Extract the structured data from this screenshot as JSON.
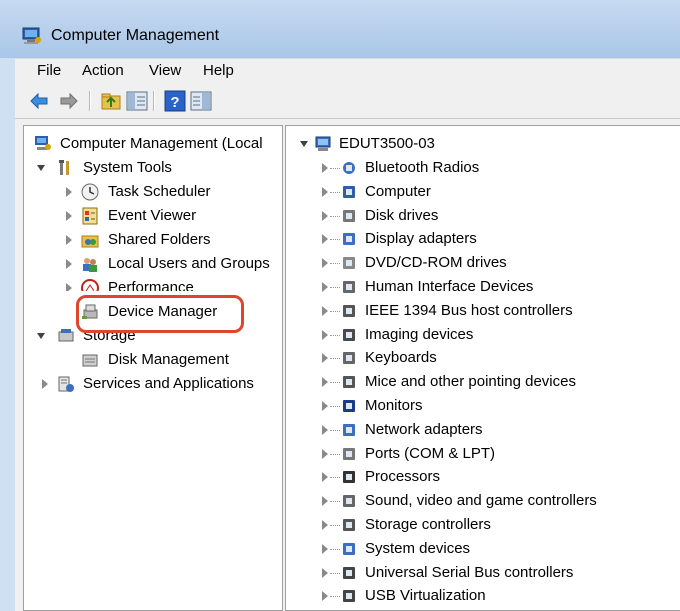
{
  "window": {
    "title": "Computer Management"
  },
  "menu": [
    "File",
    "Action",
    "View",
    "Help"
  ],
  "toolbar": {
    "icons": [
      "back-arrow-icon",
      "forward-arrow-icon",
      "up-folder-icon",
      "show-hide-tree-icon",
      "help-icon",
      "properties-pane-icon"
    ]
  },
  "left_tree": {
    "root": "Computer Management (Local",
    "system_tools": "System Tools",
    "task_scheduler": "Task Scheduler",
    "event_viewer": "Event Viewer",
    "shared_folders": "Shared Folders",
    "local_users": "Local Users and Groups",
    "performance": "Performance",
    "device_manager": "Device Manager",
    "storage": "Storage",
    "disk_management": "Disk Management",
    "services": "Services and Applications"
  },
  "right_tree": {
    "root": "EDUT3500-03",
    "items": [
      {
        "label": "Bluetooth Radios",
        "icon": "bluetooth-icon"
      },
      {
        "label": "Computer",
        "icon": "computer-icon"
      },
      {
        "label": "Disk drives",
        "icon": "disk-drive-icon"
      },
      {
        "label": "Display adapters",
        "icon": "display-adapter-icon"
      },
      {
        "label": "DVD/CD-ROM drives",
        "icon": "dvd-drive-icon"
      },
      {
        "label": "Human Interface Devices",
        "icon": "hid-icon"
      },
      {
        "label": "IEEE 1394 Bus host controllers",
        "icon": "ieee1394-icon"
      },
      {
        "label": "Imaging devices",
        "icon": "imaging-device-icon"
      },
      {
        "label": "Keyboards",
        "icon": "keyboard-icon"
      },
      {
        "label": "Mice and other pointing devices",
        "icon": "mouse-icon"
      },
      {
        "label": "Monitors",
        "icon": "monitor-icon"
      },
      {
        "label": "Network adapters",
        "icon": "network-adapter-icon"
      },
      {
        "label": "Ports (COM & LPT)",
        "icon": "port-icon"
      },
      {
        "label": "Processors",
        "icon": "processor-icon"
      },
      {
        "label": "Sound, video and game controllers",
        "icon": "sound-icon"
      },
      {
        "label": "Storage controllers",
        "icon": "storage-controller-icon"
      },
      {
        "label": "System devices",
        "icon": "system-devices-icon"
      },
      {
        "label": "Universal Serial Bus controllers",
        "icon": "usb-icon"
      },
      {
        "label": "USB Virtualization",
        "icon": "usb-virtualization-icon"
      }
    ]
  },
  "colors": {
    "highlight_border": "#e0452b"
  }
}
